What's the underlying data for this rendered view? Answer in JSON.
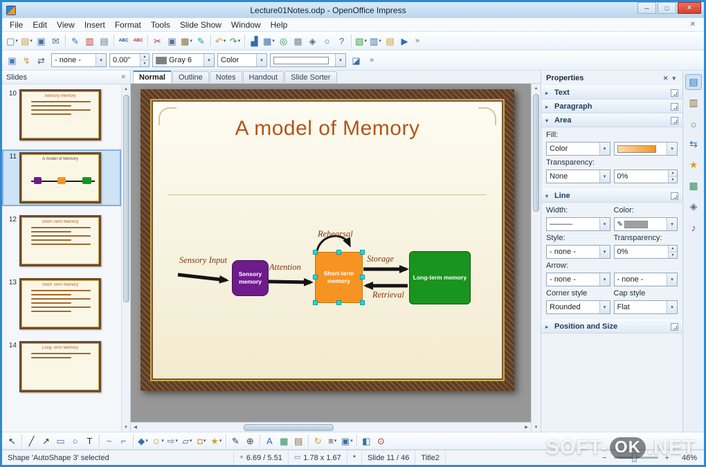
{
  "window": {
    "title": "Lecture01Notes.odp - OpenOffice Impress",
    "accent_color": "#2b8ad6"
  },
  "titlebar": {
    "minimize_glyph": "─",
    "maximize_glyph": "□",
    "close_glyph": "✕",
    "close_color": "#d3412f"
  },
  "menubar": {
    "items": [
      "File",
      "Edit",
      "View",
      "Insert",
      "Format",
      "Tools",
      "Slide Show",
      "Window",
      "Help"
    ],
    "close_glyph": "✕"
  },
  "toolbar_main": {
    "icons": [
      {
        "name": "new-document",
        "glyph": "▢",
        "color": "#5b79a6",
        "dd": true
      },
      {
        "name": "open-document",
        "glyph": "▤",
        "color": "#c89a3f",
        "dd": true
      },
      {
        "name": "save",
        "glyph": "▣",
        "color": "#3a6ea5"
      },
      {
        "name": "email",
        "glyph": "✉",
        "color": "#55718f"
      },
      {
        "sep": true
      },
      {
        "name": "edit-file",
        "glyph": "✎",
        "color": "#2e7cc3"
      },
      {
        "name": "export-pdf",
        "glyph": "▥",
        "color": "#c0392b"
      },
      {
        "name": "print",
        "glyph": "▤",
        "color": "#6a7a8a"
      },
      {
        "sep": true
      },
      {
        "name": "spelling",
        "glyph": "ABC",
        "color": "#1f4e79"
      },
      {
        "name": "autospellcheck",
        "glyph": "ABC",
        "color": "#b03030"
      },
      {
        "sep": true
      },
      {
        "name": "cut",
        "glyph": "✂",
        "color": "#b03030"
      },
      {
        "name": "copy",
        "glyph": "▣",
        "color": "#55718f"
      },
      {
        "name": "paste",
        "glyph": "▦",
        "color": "#8a6d3b",
        "dd": true
      },
      {
        "name": "clone-formatting",
        "glyph": "✎",
        "color": "#17a2a8"
      },
      {
        "sep": true
      },
      {
        "name": "undo",
        "glyph": "↶",
        "color": "#d69c2f",
        "dd": true
      },
      {
        "name": "redo",
        "glyph": "↷",
        "color": "#3f9d3f",
        "dd": true
      },
      {
        "sep": true
      },
      {
        "name": "chart",
        "glyph": "▟",
        "color": "#2f6fb0"
      },
      {
        "name": "table",
        "glyph": "▦",
        "color": "#3a6ea5",
        "dd": true
      },
      {
        "name": "hyperlink",
        "glyph": "◎",
        "color": "#2e8b57"
      },
      {
        "name": "show-grid",
        "glyph": "▩",
        "color": "#7a8a9a"
      },
      {
        "name": "navigator",
        "glyph": "◈",
        "color": "#55718f"
      },
      {
        "name": "zoom",
        "glyph": "○",
        "color": "#2f6fb0"
      },
      {
        "name": "help",
        "glyph": "?",
        "color": "#2f6fb0"
      },
      {
        "sep": true
      },
      {
        "name": "new-slide",
        "glyph": "▧",
        "color": "#3f9d3f",
        "dd": true
      },
      {
        "name": "slide-layout",
        "glyph": "▥",
        "color": "#3a6ea5",
        "dd": true
      },
      {
        "name": "slide-design",
        "glyph": "▤",
        "color": "#d69c2f"
      },
      {
        "name": "start-presentation",
        "glyph": "▶",
        "color": "#2f6fb0"
      }
    ],
    "overflow_glyph": "»"
  },
  "toolbar_line": {
    "icons": [
      {
        "name": "styles-window",
        "glyph": "▣",
        "color": "#4a7ab5"
      },
      {
        "name": "anchor",
        "glyph": "↯",
        "color": "#d69c2f"
      },
      {
        "name": "arrow-style",
        "glyph": "⇄",
        "color": "#45586c"
      }
    ],
    "line_style_value": "- none -",
    "line_width_value": "0.00\"",
    "line_color_value": "Gray 6",
    "line_color_swatch": "#808080",
    "area_style_value": "Color",
    "fill_color_swatch": "#ffffff",
    "shadow_glyph": "◪",
    "overflow_glyph": "»"
  },
  "slides_panel": {
    "title": "Slides",
    "close_glyph": "✕",
    "slides": [
      {
        "number": "10",
        "title": "Sensory Memory",
        "type": "bullets",
        "line_count": 4,
        "selected": false
      },
      {
        "number": "11",
        "title": "A model of Memory",
        "type": "diagram",
        "line_count": 0,
        "selected": true
      },
      {
        "number": "12",
        "title": "Short-Term Memory",
        "type": "bullets",
        "line_count": 5,
        "selected": false
      },
      {
        "number": "13",
        "title": "Short Term memory",
        "type": "bullets",
        "line_count": 6,
        "selected": false
      },
      {
        "number": "14",
        "title": "Long-Term Memory",
        "type": "bullets",
        "line_count": 2,
        "selected": false
      }
    ]
  },
  "view_tabs": {
    "tabs": [
      "Normal",
      "Outline",
      "Notes",
      "Handout",
      "Slide Sorter"
    ],
    "active": "Normal"
  },
  "slide": {
    "title": "A model of Memory",
    "title_color": "#b4551b",
    "label_color": "#7a3a12",
    "handle_color": "#17dbe3",
    "labels": {
      "input": "Sensory Input",
      "attention": "Attention",
      "rehearsal": "Rehearsal",
      "storage": "Storage",
      "retrieval": "Retrieval"
    },
    "boxes": [
      {
        "name": "sensory-memory",
        "label": "Sensory memory",
        "color": "#6e1b8c"
      },
      {
        "name": "short-term-memory",
        "label": "Short-term memory",
        "color": "#f79320",
        "selected": true
      },
      {
        "name": "long-term-memory",
        "label": "Long-term memory",
        "color": "#19941f"
      }
    ]
  },
  "properties_panel": {
    "title": "Properties",
    "close_glyph": "✕",
    "menu_glyph": "▾",
    "sections": {
      "text": "Text",
      "paragraph": "Paragraph",
      "area": "Area",
      "line": "Line",
      "possize": "Position and Size"
    },
    "area": {
      "fill_label": "Fill:",
      "fill_type": "Color",
      "fill_swatch": "linear-gradient(90deg,#ffd9a6,#f7941e)",
      "transparency_label": "Transparency:",
      "transparency_type": "None",
      "transparency_value": "0%"
    },
    "line": {
      "width_label": "Width:",
      "width_value": "———",
      "color_label": "Color:",
      "color_glyph": "✎",
      "color_swatch": "#a0a0a0",
      "style_label": "Style:",
      "style_value": "- none -",
      "transparency_label": "Transparency:",
      "transparency_value": "0%",
      "arrow_label": "Arrow:",
      "arrow_start_value": "- none -",
      "arrow_end_value": "- none -",
      "corner_label": "Corner style",
      "corner_value": "Rounded",
      "cap_label": "Cap style",
      "cap_value": "Flat"
    }
  },
  "sidebar_tabs": {
    "icons": [
      {
        "name": "properties",
        "glyph": "▤",
        "color": "#2f6fb0",
        "active": true
      },
      {
        "name": "master-pages",
        "glyph": "▥",
        "color": "#8a6d3b"
      },
      {
        "name": "custom-animation",
        "glyph": "☼",
        "color": "#3f9d3f"
      },
      {
        "name": "slide-transition",
        "glyph": "⇆",
        "color": "#2f6fb0"
      },
      {
        "name": "styles",
        "glyph": "★",
        "color": "#d69c2f"
      },
      {
        "name": "gallery",
        "glyph": "▦",
        "color": "#2e8b57"
      },
      {
        "name": "navigator",
        "glyph": "◈",
        "color": "#55718f"
      },
      {
        "name": "media",
        "glyph": "♪",
        "color": "#7a4a9a"
      }
    ]
  },
  "drawing_toolbar": {
    "icons": [
      {
        "name": "select",
        "glyph": "↖",
        "color": "#333333"
      },
      {
        "sep": true
      },
      {
        "name": "line",
        "glyph": "╱",
        "color": "#333333"
      },
      {
        "name": "line-arrow",
        "glyph": "↗",
        "color": "#333333"
      },
      {
        "name": "rectangle",
        "glyph": "▭",
        "color": "#3a6ea5"
      },
      {
        "name": "ellipse",
        "glyph": "○",
        "color": "#3a6ea5"
      },
      {
        "name": "text",
        "glyph": "T",
        "color": "#333333"
      },
      {
        "sep": true
      },
      {
        "name": "curve",
        "glyph": "~",
        "color": "#3a6ea5"
      },
      {
        "name": "connector",
        "glyph": "⌐",
        "color": "#3a6ea5"
      },
      {
        "sep": true
      },
      {
        "name": "basic-shapes",
        "glyph": "◆",
        "color": "#3a6ea5",
        "dd": true
      },
      {
        "name": "symbol-shapes",
        "glyph": "☺",
        "color": "#d69c2f",
        "dd": true
      },
      {
        "name": "block-arrows",
        "glyph": "⇨",
        "color": "#3a6ea5",
        "dd": true
      },
      {
        "name": "flowchart",
        "glyph": "▱",
        "color": "#3a6ea5",
        "dd": true
      },
      {
        "name": "callouts",
        "glyph": "◘",
        "color": "#d69c2f",
        "dd": true
      },
      {
        "name": "stars",
        "glyph": "★",
        "color": "#d6a02f",
        "dd": true
      },
      {
        "sep": true
      },
      {
        "name": "edit-points",
        "glyph": "✎",
        "color": "#444444"
      },
      {
        "name": "glue-points",
        "glyph": "⊕",
        "color": "#444444"
      },
      {
        "sep": true
      },
      {
        "name": "fontwork",
        "glyph": "A",
        "color": "#2f6fb0"
      },
      {
        "name": "from-file",
        "glyph": "▦",
        "color": "#2e8b57"
      },
      {
        "name": "gallery",
        "glyph": "▤",
        "color": "#8a6d3b"
      },
      {
        "sep": true
      },
      {
        "name": "rotate",
        "glyph": "↻",
        "color": "#d69c2f"
      },
      {
        "name": "alignment",
        "glyph": "≡",
        "color": "#444444",
        "dd": true
      },
      {
        "name": "arrange",
        "glyph": "▣",
        "color": "#3a6ea5",
        "dd": true
      },
      {
        "sep": true
      },
      {
        "name": "extrusion",
        "glyph": "◧",
        "color": "#3a6ea5"
      },
      {
        "name": "interaction",
        "glyph": "⊙",
        "color": "#b03030"
      }
    ]
  },
  "status_bar": {
    "selection": "Shape 'AutoShape 3' selected",
    "position": "6.69 / 5.51",
    "size": "1.78 x 1.67",
    "modified": "*",
    "slide": "Slide 11 / 46",
    "layout": "Title2",
    "zoom_minus": "−",
    "zoom_plus": "+",
    "zoom": "46%"
  },
  "watermark": {
    "pre": "SOFT-",
    "mid": "OK",
    "post": ".NET"
  }
}
